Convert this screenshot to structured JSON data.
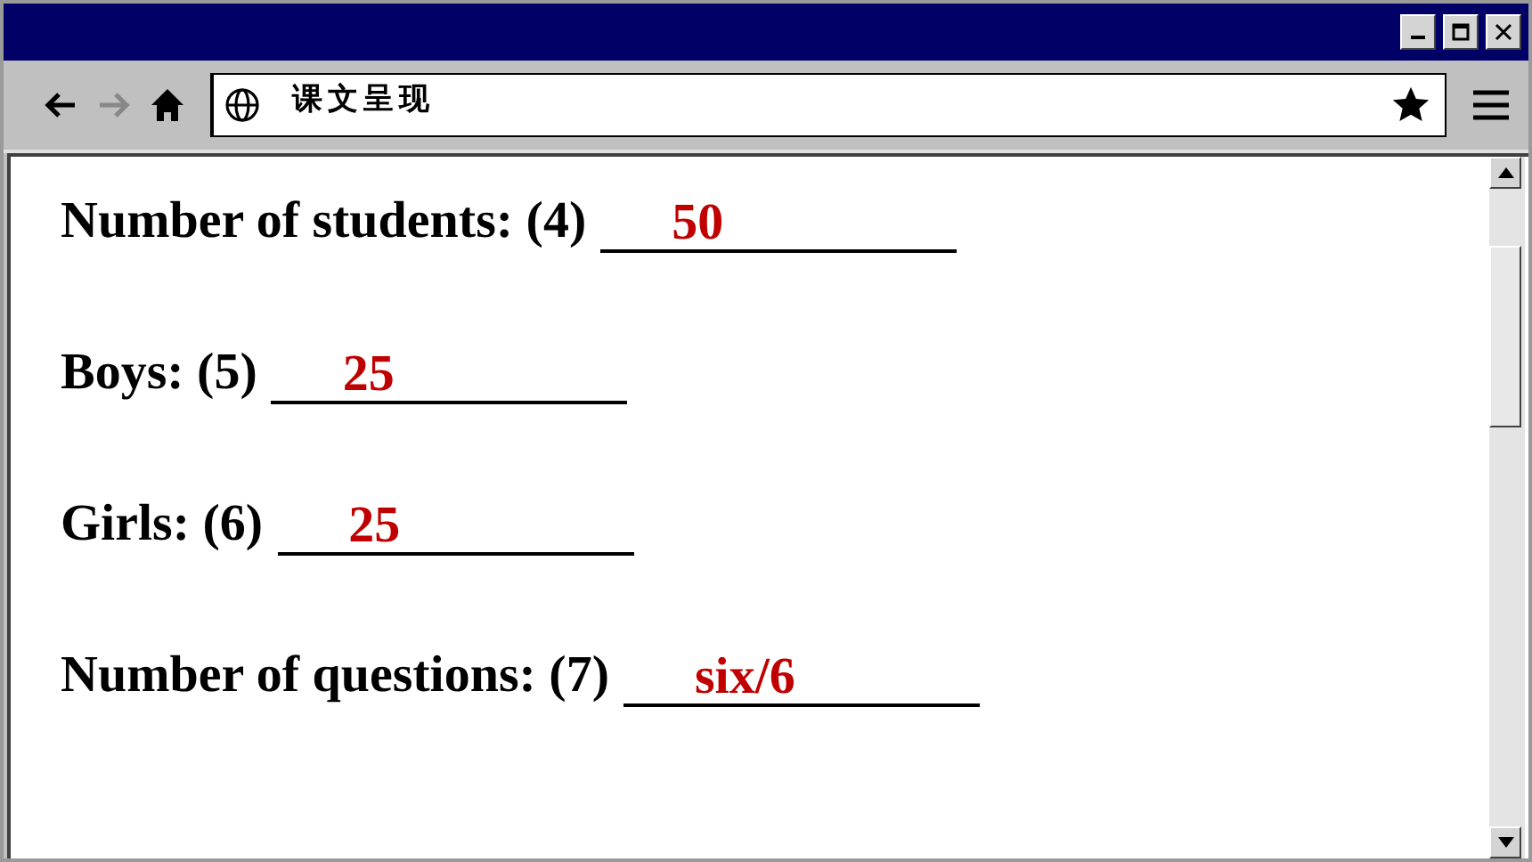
{
  "toolbar": {
    "back": {
      "disabled": false
    },
    "forward": {
      "disabled": true
    },
    "address": "课文呈现"
  },
  "blanks": [
    {
      "label": "Number of students: (4)",
      "answer": "50"
    },
    {
      "label": "Boys: (5)",
      "answer": "25"
    },
    {
      "label": "Girls: (6)",
      "answer": "25"
    },
    {
      "label": "Number of questions: (7)",
      "answer": "six/6"
    }
  ]
}
